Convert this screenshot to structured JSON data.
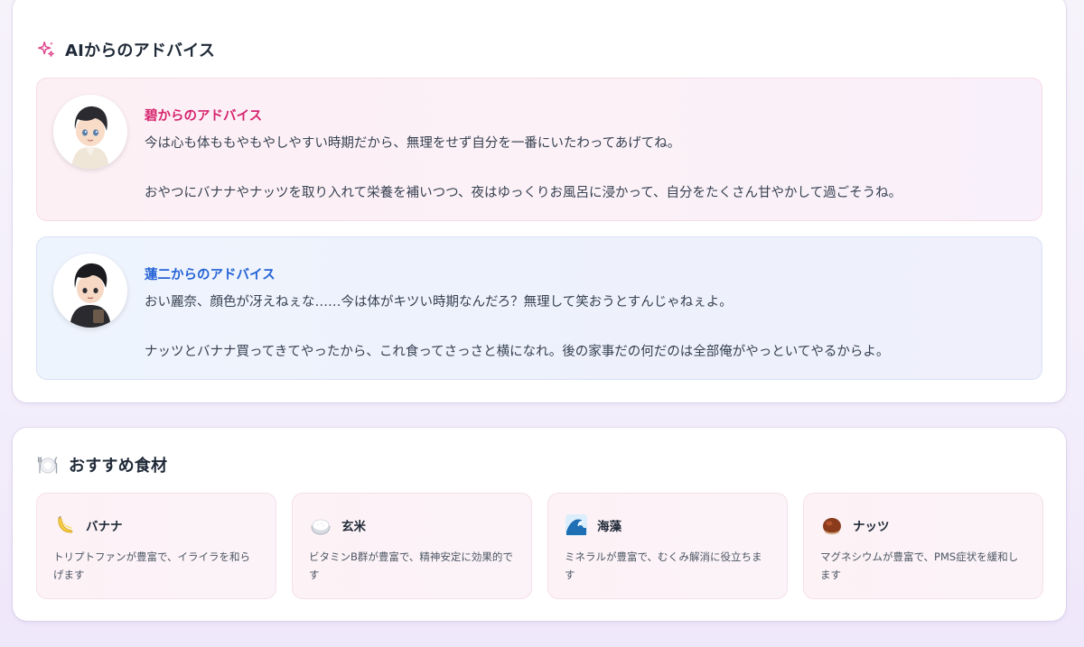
{
  "advice_section": {
    "title": "AIからのアドバイス",
    "icon": "sparkle-icon",
    "accent": "#e0458c",
    "items": [
      {
        "name": "碧からのアドバイス",
        "line1": "今は心も体ももやもやしやすい時期だから、無理をせず自分を一番にいたわってあげてね。",
        "line2": "おやつにバナナやナッツを取り入れて栄養を補いつつ、夜はゆっくりお風呂に浸かって、自分をたくさん甘やかして過ごそうね。",
        "name_color": "#d6246e"
      },
      {
        "name": "蓮二からのアドバイス",
        "line1": "おい麗奈、顔色が冴えねぇな……今は体がキツい時期なんだろ？無理して笑おうとすんじゃねぇよ。",
        "line2": "ナッツとバナナ買ってきてやったから、これ食ってさっさと横になれ。後の家事だの何だのは全部俺がやっといてやるからよ。",
        "name_color": "#2563d6"
      }
    ]
  },
  "food_section": {
    "title": "おすすめ食材",
    "icon": "plate-icon",
    "items": [
      {
        "name": "バナナ",
        "icon": "banana-icon",
        "desc": "トリプトファンが豊富で、イライラを和らげます"
      },
      {
        "name": "玄米",
        "icon": "rice-icon",
        "desc": "ビタミンB群が豊富で、精神安定に効果的です"
      },
      {
        "name": "海藻",
        "icon": "wave-icon",
        "desc": "ミネラルが豊富で、むくみ解消に役立ちます"
      },
      {
        "name": "ナッツ",
        "icon": "chestnut-icon",
        "desc": "マグネシウムが豊富で、PMS症状を緩和します"
      }
    ]
  }
}
